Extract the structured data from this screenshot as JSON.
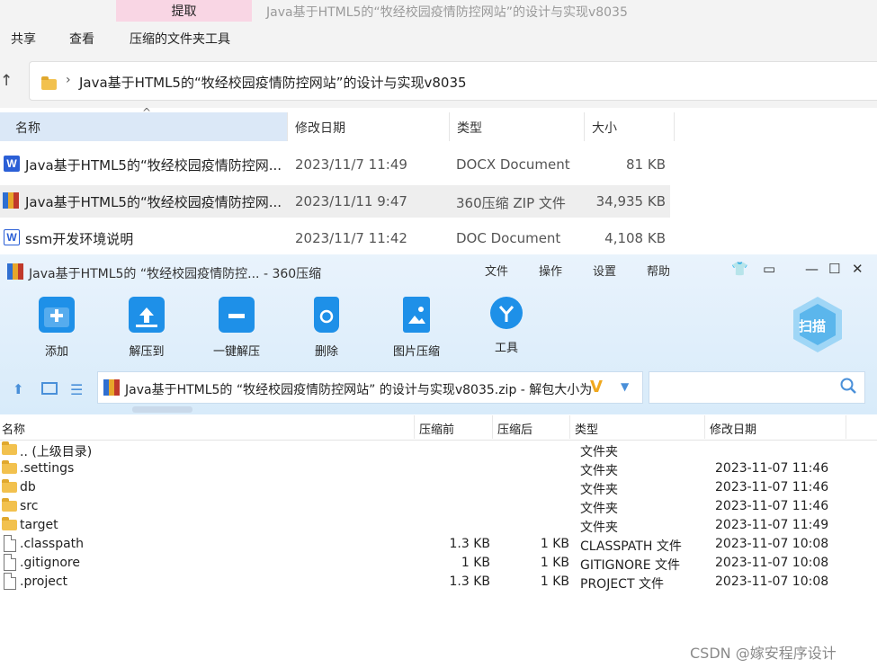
{
  "explorer": {
    "extract_tab": "提取",
    "window_title": "Java基于HTML5的“牧经校园疫情防控网站”的设计与实现v8035",
    "ribbon": [
      "共享",
      "查看",
      "压缩的文件夹工具"
    ],
    "address": "Java基于HTML5的“牧经校园疫情防控网站”的设计与实现v8035",
    "columns": [
      "名称",
      "修改日期",
      "类型",
      "大小"
    ],
    "files": [
      {
        "name": "Java基于HTML5的“牧经校园疫情防控网...",
        "date": "2023/11/7 11:49",
        "type": "DOCX Document",
        "size": "81 KB",
        "icon": "word-docx-icon"
      },
      {
        "name": "Java基于HTML5的“牧经校园疫情防控网...",
        "date": "2023/11/11 9:47",
        "type": "360压缩 ZIP 文件",
        "size": "34,935 KB",
        "icon": "zip-archive-icon"
      },
      {
        "name": "ssm开发环境说明",
        "date": "2023/11/7 11:42",
        "type": "DOC Document",
        "size": "4,108 KB",
        "icon": "word-doc-icon"
      }
    ]
  },
  "zip": {
    "title": "Java基于HTML5的 “牧经校园疫情防控... - 360压缩",
    "menu": [
      "文件",
      "操作",
      "设置",
      "帮助"
    ],
    "toolbar": [
      "添加",
      "解压到",
      "一键解压",
      "删除",
      "图片压缩",
      "工具"
    ],
    "scan_label": "扫描",
    "path": "Java基于HTML5的 “牧经校园疫情防控网站” 的设计与实现v8035.zip - 解包大小为",
    "columns": [
      "名称",
      "压缩前",
      "压缩后",
      "类型",
      "修改日期"
    ],
    "entries": [
      {
        "name": ".. (上级目录)",
        "before": "",
        "after": "",
        "type": "文件夹",
        "date": "",
        "kind": "folder"
      },
      {
        "name": ".settings",
        "before": "",
        "after": "",
        "type": "文件夹",
        "date": "2023-11-07 11:46",
        "kind": "folder"
      },
      {
        "name": "db",
        "before": "",
        "after": "",
        "type": "文件夹",
        "date": "2023-11-07 11:46",
        "kind": "folder"
      },
      {
        "name": "src",
        "before": "",
        "after": "",
        "type": "文件夹",
        "date": "2023-11-07 11:46",
        "kind": "folder"
      },
      {
        "name": "target",
        "before": "",
        "after": "",
        "type": "文件夹",
        "date": "2023-11-07 11:49",
        "kind": "folder"
      },
      {
        "name": ".classpath",
        "before": "1.3 KB",
        "after": "1 KB",
        "type": "CLASSPATH 文件",
        "date": "2023-11-07 10:08",
        "kind": "file"
      },
      {
        "name": ".gitignore",
        "before": "1 KB",
        "after": "1 KB",
        "type": "GITIGNORE 文件",
        "date": "2023-11-07 10:08",
        "kind": "file"
      },
      {
        "name": ".project",
        "before": "1.3 KB",
        "after": "1 KB",
        "type": "PROJECT 文件",
        "date": "2023-11-07 10:08",
        "kind": "file"
      }
    ]
  },
  "watermark": "CSDN @嫁安程序设计",
  "colors": {
    "accent": "#1e90e8",
    "selection": "#eeeeee",
    "zip_header_bg": "#d8ebfa"
  }
}
